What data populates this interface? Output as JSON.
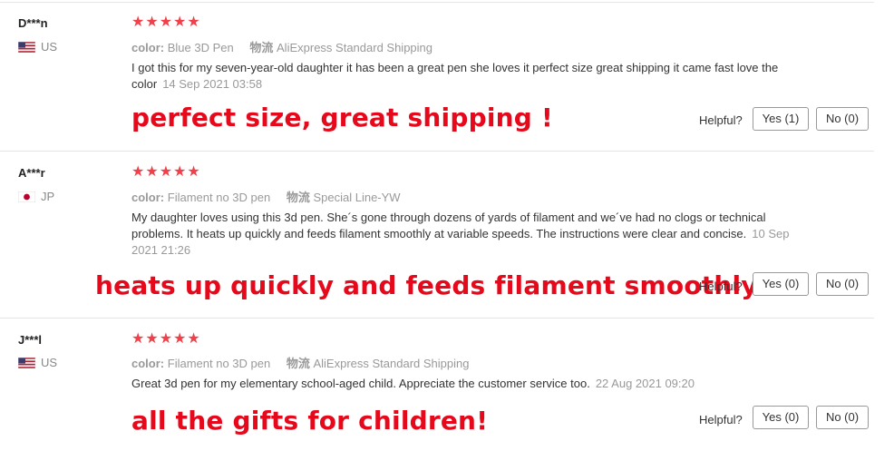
{
  "labels": {
    "color": "color:",
    "logistics": "物流",
    "helpful": "Helpful?",
    "stars": "★★★★★"
  },
  "reviews": [
    {
      "user": "D***n",
      "country": "US",
      "flag_icon": "us-flag-icon",
      "rating": 5,
      "color_value": "Blue 3D Pen",
      "shipping": "AliExpress Standard Shipping",
      "text": "I got this for my seven-year-old daughter it has been a great pen she loves it perfect size great shipping it came fast love the color",
      "date": "14 Sep 2021 03:58",
      "overlay": "perfect size, great shipping !",
      "yes_label": "Yes (1)",
      "no_label": "No (0)"
    },
    {
      "user": "A***r",
      "country": "JP",
      "flag_icon": "jp-flag-icon",
      "rating": 5,
      "color_value": "Filament no 3D pen",
      "shipping": "Special Line-YW",
      "text": "My daughter loves using this 3d pen. She´s gone through dozens of yards of filament and we´ve had no clogs or technical problems. It heats up quickly and feeds filament smoothly at variable speeds. The instructions were clear and concise.",
      "date": "10 Sep 2021 21:26",
      "overlay": "heats up quickly and feeds filament smoothly!",
      "yes_label": "Yes (0)",
      "no_label": "No (0)"
    },
    {
      "user": "J***l",
      "country": "US",
      "flag_icon": "us-flag-icon",
      "rating": 5,
      "color_value": "Filament no 3D pen",
      "shipping": "AliExpress Standard Shipping",
      "text": "Great 3d pen for my elementary school-aged child. Appreciate the customer service too.",
      "date": "22 Aug 2021 09:20",
      "overlay": "all the gifts for children!",
      "yes_label": "Yes (0)",
      "no_label": "No (0)"
    }
  ]
}
